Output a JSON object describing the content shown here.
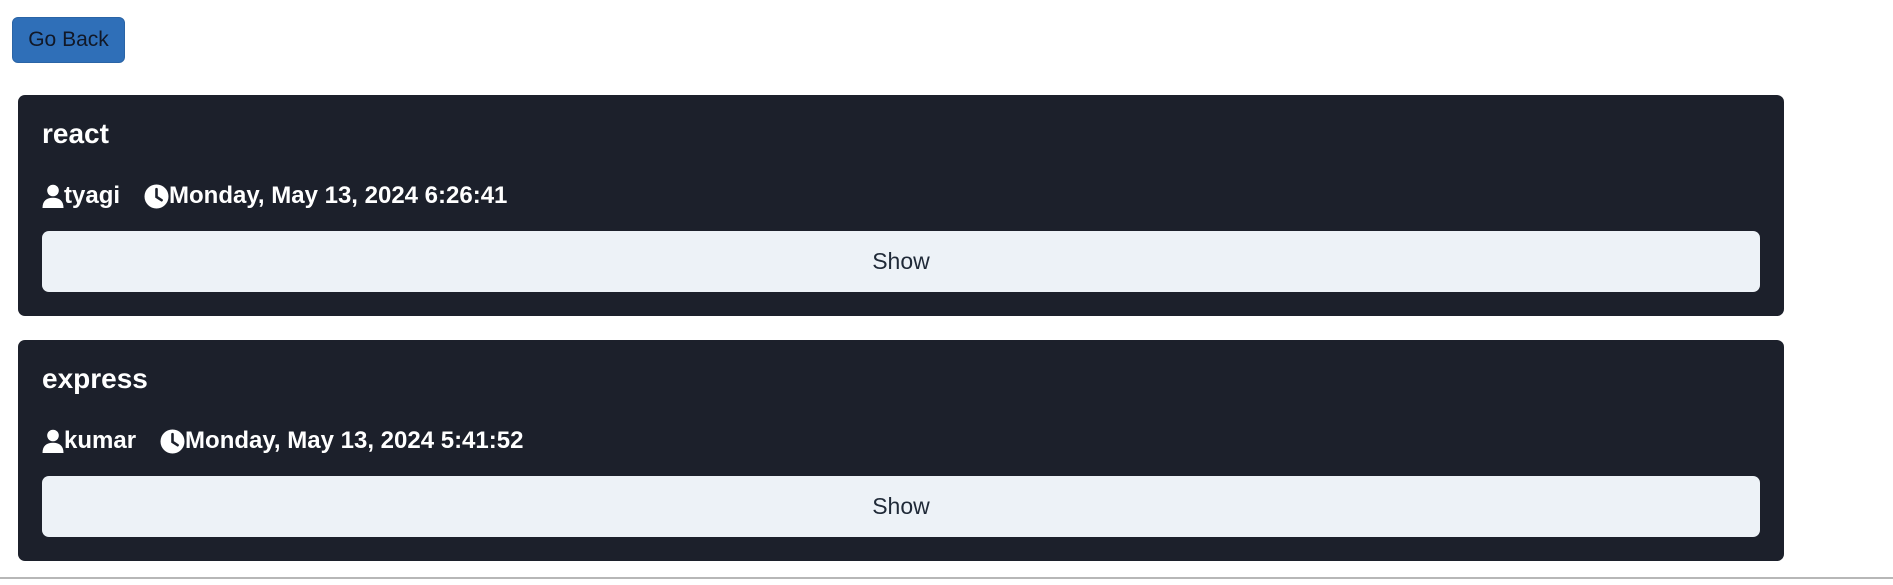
{
  "header": {
    "go_back_label": "Go Back"
  },
  "posts": [
    {
      "title": "react",
      "author": "tyagi",
      "timestamp": "Monday, May 13, 2024 6:26:41",
      "show_label": "Show"
    },
    {
      "title": "express",
      "author": "kumar",
      "timestamp": "Monday, May 13, 2024 5:41:52",
      "show_label": "Show"
    }
  ],
  "icons": {
    "author": "user-icon",
    "time": "clock-icon"
  },
  "colors": {
    "card_background": "#1c202b",
    "primary_button": "#2f6fb8",
    "show_button_background": "#edf2f7",
    "card_text": "#ffffff"
  }
}
